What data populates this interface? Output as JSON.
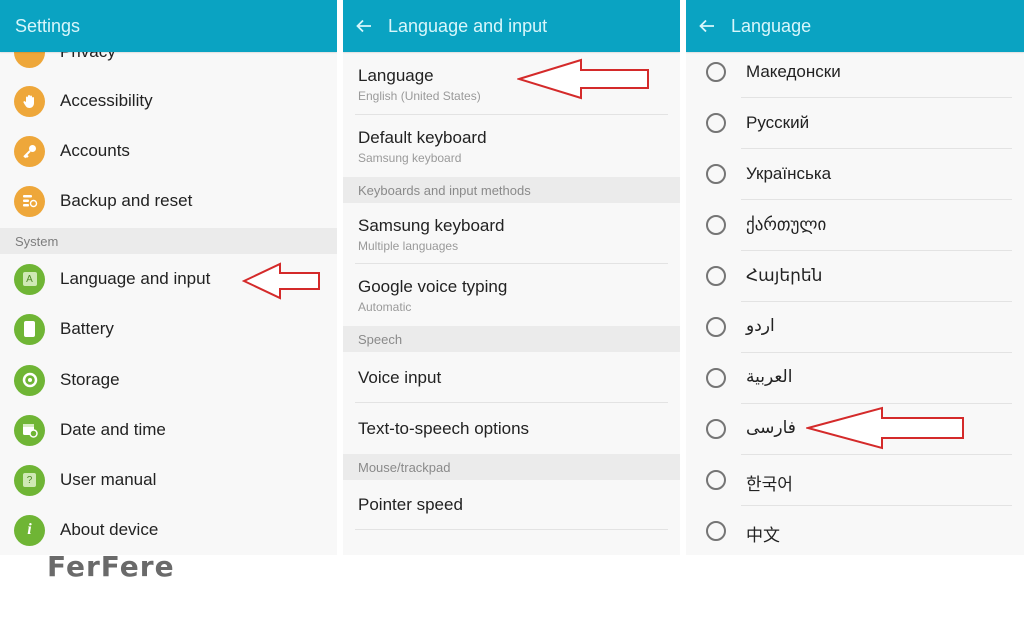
{
  "panels": {
    "settings": {
      "title": "Settings",
      "partial_item": "Privacy",
      "items_top": [
        {
          "label": "Accessibility",
          "icon": "hand-icon",
          "color": "#eea73a"
        },
        {
          "label": "Accounts",
          "icon": "key-icon",
          "color": "#eea73a"
        },
        {
          "label": "Backup and reset",
          "icon": "backup-icon",
          "color": "#eea73a"
        }
      ],
      "section_system": "System",
      "items_system": [
        {
          "label": "Language and input",
          "icon": "language-icon",
          "color": "#6fb535"
        },
        {
          "label": "Battery",
          "icon": "battery-icon",
          "color": "#6fb535"
        },
        {
          "label": "Storage",
          "icon": "storage-icon",
          "color": "#6fb535"
        },
        {
          "label": "Date and time",
          "icon": "calendar-clock-icon",
          "color": "#6fb535"
        },
        {
          "label": "User manual",
          "icon": "help-book-icon",
          "color": "#6fb535"
        },
        {
          "label": "About device",
          "icon": "info-icon",
          "color": "#6fb535"
        }
      ]
    },
    "language_and_input": {
      "title": "Language and input",
      "items": [
        {
          "title": "Language",
          "sub": "English (United States)"
        },
        {
          "title": "Default keyboard",
          "sub": "Samsung keyboard"
        }
      ],
      "section_keyboards": "Keyboards and input methods",
      "keyboard_items": [
        {
          "title": "Samsung keyboard",
          "sub": "Multiple languages"
        },
        {
          "title": "Google voice typing",
          "sub": "Automatic"
        }
      ],
      "section_speech": "Speech",
      "speech_items": [
        {
          "title": "Voice input"
        },
        {
          "title": "Text-to-speech options"
        }
      ],
      "section_mouse": "Mouse/trackpad",
      "mouse_items": [
        {
          "title": "Pointer speed"
        }
      ]
    },
    "language": {
      "title": "Language",
      "options": [
        {
          "label": "Македонски",
          "selected": false
        },
        {
          "label": "Русский",
          "selected": false
        },
        {
          "label": "Українська",
          "selected": false
        },
        {
          "label": "ქართული",
          "selected": false
        },
        {
          "label": "Հայերեն",
          "selected": false
        },
        {
          "label": "اردو",
          "selected": false
        },
        {
          "label": "العربية",
          "selected": false
        },
        {
          "label": "فارسی",
          "selected": false
        },
        {
          "label": "한국어",
          "selected": false
        },
        {
          "label": "中文",
          "selected": false
        }
      ]
    }
  },
  "annotations": {
    "arrow_color": "#d42a2a",
    "arrows_point_to": [
      "Language and input",
      "Language",
      "فارسی"
    ]
  },
  "watermark": "FerFere",
  "colors": {
    "appbar": "#0aa3c2",
    "appbar_text": "#d8f6fb",
    "orange_icon": "#eea73a",
    "green_icon": "#6fb535"
  }
}
